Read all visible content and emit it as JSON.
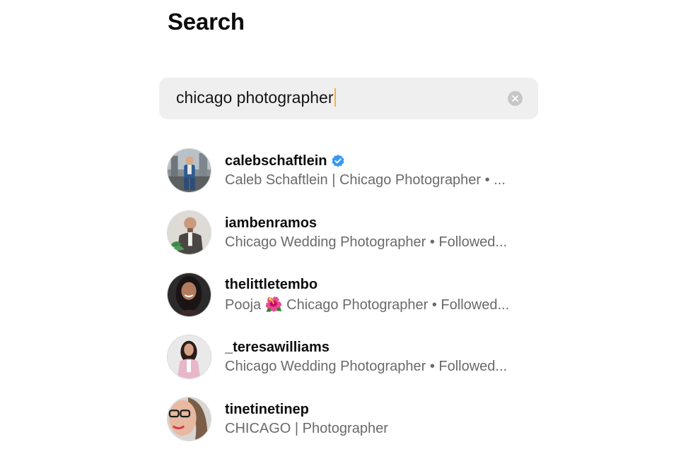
{
  "header": {
    "title": "Search"
  },
  "search": {
    "value": "chicago photographer",
    "clear_icon": "clear-circle-icon"
  },
  "results": [
    {
      "username": "calebschaftlein",
      "verified": true,
      "subtitle": "Caleb Schaftlein | Chicago Photographer • ...",
      "avatar": "profile-photo-man-suit"
    },
    {
      "username": "iambenramos",
      "verified": false,
      "subtitle": "Chicago Wedding Photographer • Followed...",
      "avatar": "profile-photo-man-bald"
    },
    {
      "username": "thelittletembo",
      "verified": false,
      "subtitle": "Pooja 🌺 Chicago Photographer • Followed...",
      "avatar": "profile-photo-woman-dark-hair"
    },
    {
      "username": "_teresawilliams",
      "verified": false,
      "subtitle": "Chicago Wedding Photographer • Followed...",
      "avatar": "profile-photo-woman-pink-blazer"
    },
    {
      "username": "tinetinetinep",
      "verified": false,
      "subtitle": "CHICAGO | Photographer",
      "avatar": "profile-photo-woman-glasses"
    }
  ],
  "colors": {
    "verified_badge": "#3897f0",
    "search_background": "#efefef",
    "caret": "#f3b23c",
    "subtitle_text": "#6a6a6a"
  }
}
